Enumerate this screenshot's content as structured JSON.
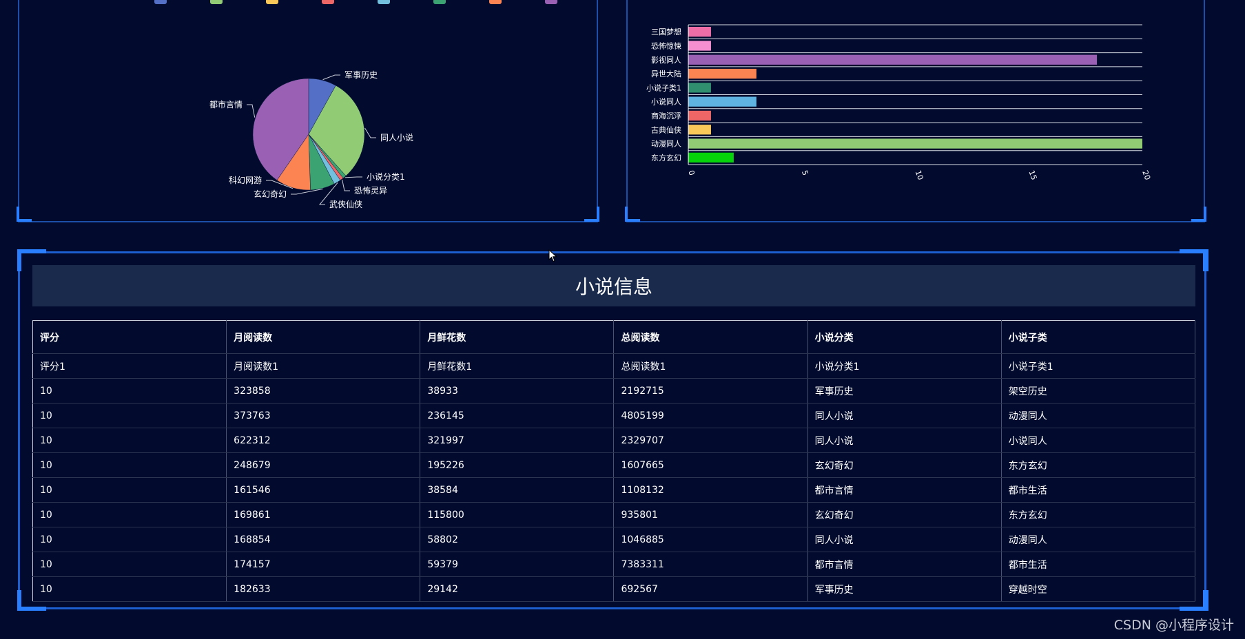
{
  "pie_panel": {
    "title": "",
    "legend_colors": [
      "#5470c6",
      "#91cc75",
      "#fac858",
      "#ee6666",
      "#73c0de",
      "#3ba272",
      "#fc8452",
      "#9a60b4"
    ],
    "labels": [
      "军事历史",
      "同人小说",
      "小说分类1",
      "恐怖灵异",
      "武侠仙侠",
      "玄幻奇幻",
      "科幻网游",
      "都市言情"
    ]
  },
  "bar_panel": {
    "title": ""
  },
  "chart_data": [
    {
      "type": "pie",
      "title": "",
      "categories": [
        "军事历史",
        "同人小说",
        "小说分类1",
        "恐怖灵异",
        "武侠仙侠",
        "玄幻奇幻",
        "科幻网游",
        "都市言情"
      ],
      "values": [
        8,
        30,
        1,
        1,
        2,
        7,
        10,
        40
      ],
      "colors": [
        "#5470c6",
        "#91cc75",
        "#3ba272",
        "#ee6666",
        "#73c0de",
        "#3ba272",
        "#fc8452",
        "#9a60b4"
      ]
    },
    {
      "type": "bar",
      "orientation": "horizontal",
      "title": "",
      "categories": [
        "三国梦想",
        "恐怖惊悚",
        "影视同人",
        "异世大陆",
        "小说子类1",
        "小说同人",
        "商海沉浮",
        "古典仙侠",
        "动漫同人",
        "东方玄幻"
      ],
      "values": [
        1,
        1,
        18,
        3,
        1,
        3,
        1,
        1,
        20,
        2
      ],
      "colors": [
        "#ef6ea8",
        "#f58fd0",
        "#9a60b4",
        "#fc8452",
        "#2f8f6e",
        "#5fb3e0",
        "#ee6666",
        "#fac858",
        "#91cc75",
        "#06d30a"
      ],
      "xlim": [
        0,
        20
      ],
      "xticks": [
        "0",
        "5",
        "10",
        "15",
        "20"
      ],
      "grid": true
    }
  ],
  "table": {
    "title": "小说信息",
    "headers": [
      "评分",
      "月阅读数",
      "月鲜花数",
      "总阅读数",
      "小说分类",
      "小说子类"
    ],
    "rows": [
      [
        "评分1",
        "月阅读数1",
        "月鲜花数1",
        "总阅读数1",
        "小说分类1",
        "小说子类1"
      ],
      [
        "10",
        "323858",
        "38933",
        "2192715",
        "军事历史",
        "架空历史"
      ],
      [
        "10",
        "373763",
        "236145",
        "4805199",
        "同人小说",
        "动漫同人"
      ],
      [
        "10",
        "622312",
        "321997",
        "2329707",
        "同人小说",
        "小说同人"
      ],
      [
        "10",
        "248679",
        "195226",
        "1607665",
        "玄幻奇幻",
        "东方玄幻"
      ],
      [
        "10",
        "161546",
        "38584",
        "1108132",
        "都市言情",
        "都市生活"
      ],
      [
        "10",
        "169861",
        "115800",
        "935801",
        "玄幻奇幻",
        "东方玄幻"
      ],
      [
        "10",
        "168854",
        "58802",
        "1046885",
        "同人小说",
        "动漫同人"
      ],
      [
        "10",
        "174157",
        "59379",
        "7383311",
        "都市言情",
        "都市生活"
      ],
      [
        "10",
        "182633",
        "29142",
        "692567",
        "军事历史",
        "穿越时空"
      ]
    ]
  },
  "watermark": "CSDN @小程序设计"
}
